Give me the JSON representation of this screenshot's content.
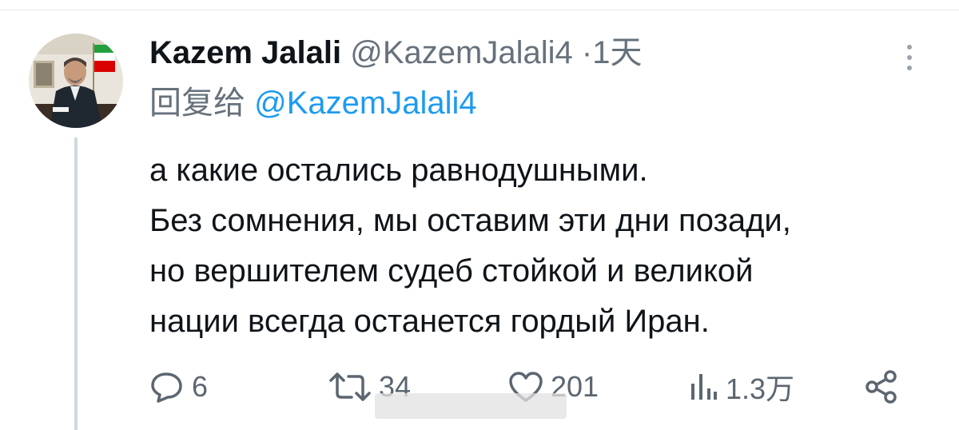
{
  "tweet": {
    "author": {
      "display_name": "Kazem Jalali",
      "handle": "@KazemJalali4",
      "separator": "·",
      "timestamp": "1天"
    },
    "reply": {
      "prefix": "回复给",
      "handle": "@KazemJalali4"
    },
    "text_lines": [
      "а какие остались равнодушными.",
      "Без сомнения, мы оставим эти дни позади,",
      "но вершителем судеб стойкой и великой",
      "нации всегда останется гордый Иран."
    ]
  },
  "actions": {
    "replies": "6",
    "reposts": "34",
    "likes": "201",
    "views": "1.3万"
  },
  "icons": {
    "more": "more-vertical-icon",
    "reply": "reply-bubble-icon",
    "repost": "repost-icon",
    "like": "heart-icon",
    "views": "bar-chart-icon",
    "share": "share-icon"
  },
  "colors": {
    "text": "#0f1419",
    "secondary": "#66717b",
    "link": "#1d9bf0",
    "thread_line": "#cfd9de",
    "icon": "#5b6670",
    "flag_green": "#239f40",
    "flag_red": "#da0000"
  }
}
